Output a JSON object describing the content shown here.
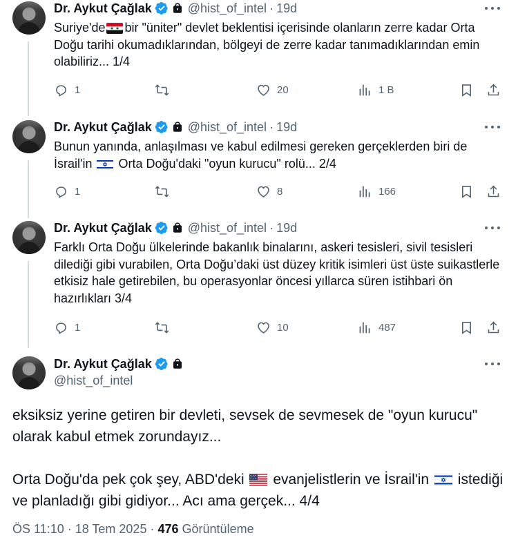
{
  "colors": {
    "text": "#0f1419",
    "muted": "#536471",
    "verified": "#1d9bf0",
    "line": "#cfd9de"
  },
  "author": {
    "name": "Dr. Aykut Çağlak",
    "handle": "@hist_of_intel"
  },
  "tweets": [
    {
      "time": "19d",
      "text_parts": [
        "Suriye'de",
        "bir \"üniter\" devlet beklentisi içerisinde olanların zerre kadar Orta Doğu tarihi okumadıklarından, bölgeyi de zerre kadar tanımadıklarından emin olabiliriz... 1/4"
      ],
      "flag": "syria-flag",
      "replies": "1",
      "reposts": "",
      "likes": "20",
      "views": "1 B"
    },
    {
      "time": "19d",
      "text_parts": [
        "Bunun yanında, anlaşılması ve kabul edilmesi gereken gerçeklerden biri de İsrail'in",
        "Orta Doğu'daki \"oyun kurucu\" rolü... 2/4"
      ],
      "flag": "israel-flag",
      "replies": "1",
      "reposts": "",
      "likes": "8",
      "views": "166"
    },
    {
      "time": "19d",
      "text": "Farklı Orta Doğu ülkelerinde bakanlık binalarını, askeri tesisleri, sivil tesisleri dilediği gibi vurabilen, Orta Doğu’daki üst düzey kritik isimleri üst üste suikastlerle etkisiz hale getirebilen, bu operasyonlar öncesi yıllarca süren istihbari ön hazırlıkları 3/4",
      "replies": "1",
      "reposts": "",
      "likes": "10",
      "views": "487"
    }
  ],
  "main_tweet": {
    "para1": "eksiksiz yerine getiren bir devleti, sevsek de sevmesek de \"oyun kurucu\" olarak kabul etmek zorundayız...",
    "para2_a": "Orta Doğu'da pek çok şey, ABD'deki",
    "para2_b": "evanjelistlerin ve İsrail'in",
    "para2_c": "istediği ve planladığı gibi gidiyor... Acı ama gerçek... 4/4",
    "flags": [
      "usa-flag",
      "israel-flag"
    ],
    "timestamp": "ÖS 11:10 · 18 Tem 2025 ·",
    "views_count": "476",
    "views_label": "Görüntüleme"
  },
  "icons": [
    "verified-badge-icon",
    "lock-icon",
    "more-icon",
    "reply-icon",
    "repost-icon",
    "like-icon",
    "views-icon",
    "bookmark-icon",
    "share-icon"
  ]
}
